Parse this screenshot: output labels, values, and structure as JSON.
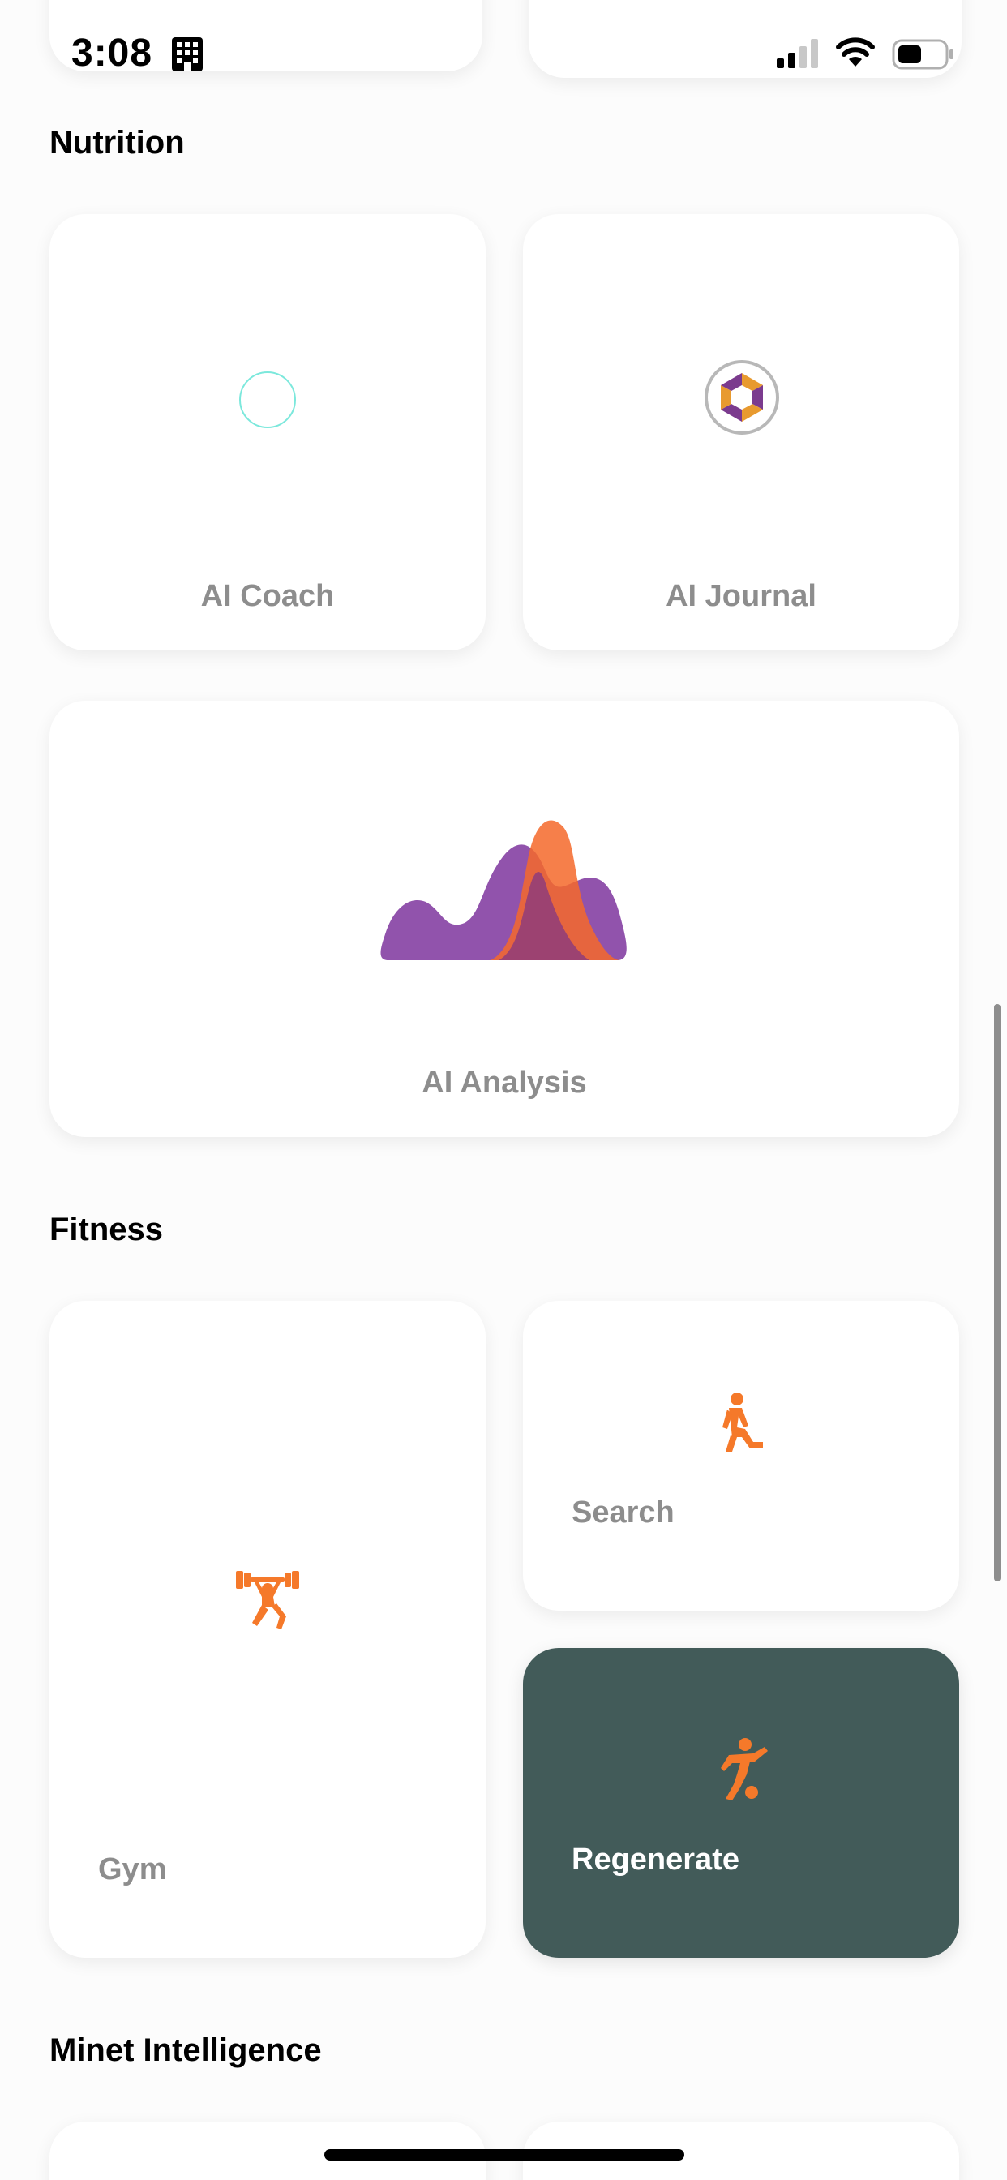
{
  "status_bar": {
    "time": "3:08"
  },
  "sections": {
    "nutrition": {
      "title": "Nutrition",
      "cards": {
        "ai_coach": "AI Coach",
        "ai_journal": "AI Journal",
        "ai_analysis": "AI Analysis"
      }
    },
    "fitness": {
      "title": "Fitness",
      "cards": {
        "gym": "Gym",
        "search": "Search",
        "regenerate": "Regenerate"
      }
    },
    "minet": {
      "title": "Minet Intelligence"
    }
  },
  "icons": {
    "building": "building-icon",
    "signal": "cellular-signal-icon",
    "wifi": "wifi-icon",
    "battery": "battery-icon",
    "coach": "circle-outline-icon",
    "journal": "aperture-logo-icon",
    "analysis": "mountain-peaks-icon",
    "gym": "weightlifting-icon",
    "search": "kneeling-person-icon",
    "regenerate": "soccer-player-icon"
  },
  "colors": {
    "accent_orange": "#f5792a",
    "analysis_purple": "#7f3f9b",
    "dark_card": "#425b59",
    "coach_ring": "#7ce8dc"
  }
}
